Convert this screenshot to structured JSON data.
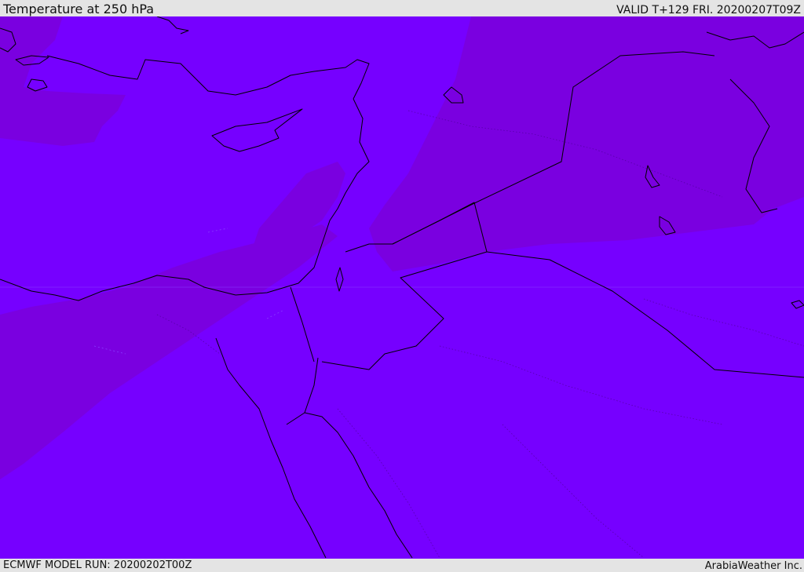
{
  "header": {
    "title": "Temperature at 250 hPa",
    "valid": "VALID T+129 FRI. 20200207T09Z"
  },
  "footer": {
    "model_run": "ECMWF MODEL RUN: 20200202T00Z",
    "credit": "ArabiaWeather Inc."
  },
  "map": {
    "field": "temperature-250hPa",
    "colors": {
      "base_violet": "#7600ff",
      "cold_band": "#7a00e0",
      "coastline": "#000000"
    }
  }
}
